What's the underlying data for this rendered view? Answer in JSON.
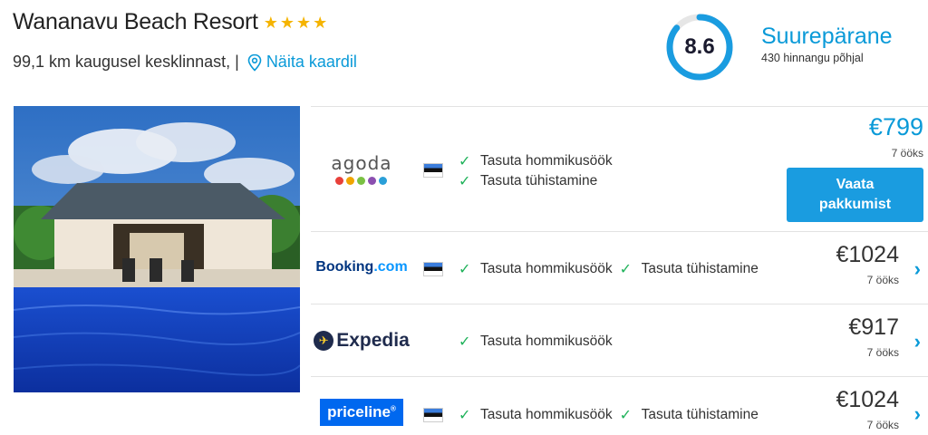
{
  "hotel": {
    "name": "Wananavu Beach Resort",
    "stars": 4,
    "distance": "99,1 km kaugusel kesklinnast, |",
    "map_link": "Näita kaardil"
  },
  "rating": {
    "score": "8.6",
    "label": "Suurepärane",
    "count": "430 hinnangu põhjal",
    "fraction": 0.86
  },
  "colors": {
    "accent": "#0a9ad8",
    "button": "#1a9ce0",
    "star": "#f5b400",
    "check": "#1fb25a"
  },
  "offers": [
    {
      "provider": "agoda",
      "features": [
        "Tasuta hommikusöök",
        "Tasuta tühistamine"
      ],
      "price": "€799",
      "nights": "7 ööks",
      "button": [
        "Vaata",
        "pakkumist"
      ]
    },
    {
      "provider_main": "Booking",
      "provider_suffix": ".com",
      "features": [
        "Tasuta hommikusöök",
        "Tasuta tühistamine"
      ],
      "price": "€1024",
      "nights": "7 ööks"
    },
    {
      "provider": "Expedia",
      "features": [
        "Tasuta hommikusöök"
      ],
      "price": "€917",
      "nights": "7 ööks"
    },
    {
      "provider": "priceline",
      "features": [
        "Tasuta hommikusöök",
        "Tasuta tühistamine"
      ],
      "price": "€1024",
      "nights": "7 ööks"
    }
  ],
  "icons": {
    "check": "✓",
    "chevron": "›",
    "star": "★",
    "expedia_mark": "✈",
    "registered": "®"
  }
}
